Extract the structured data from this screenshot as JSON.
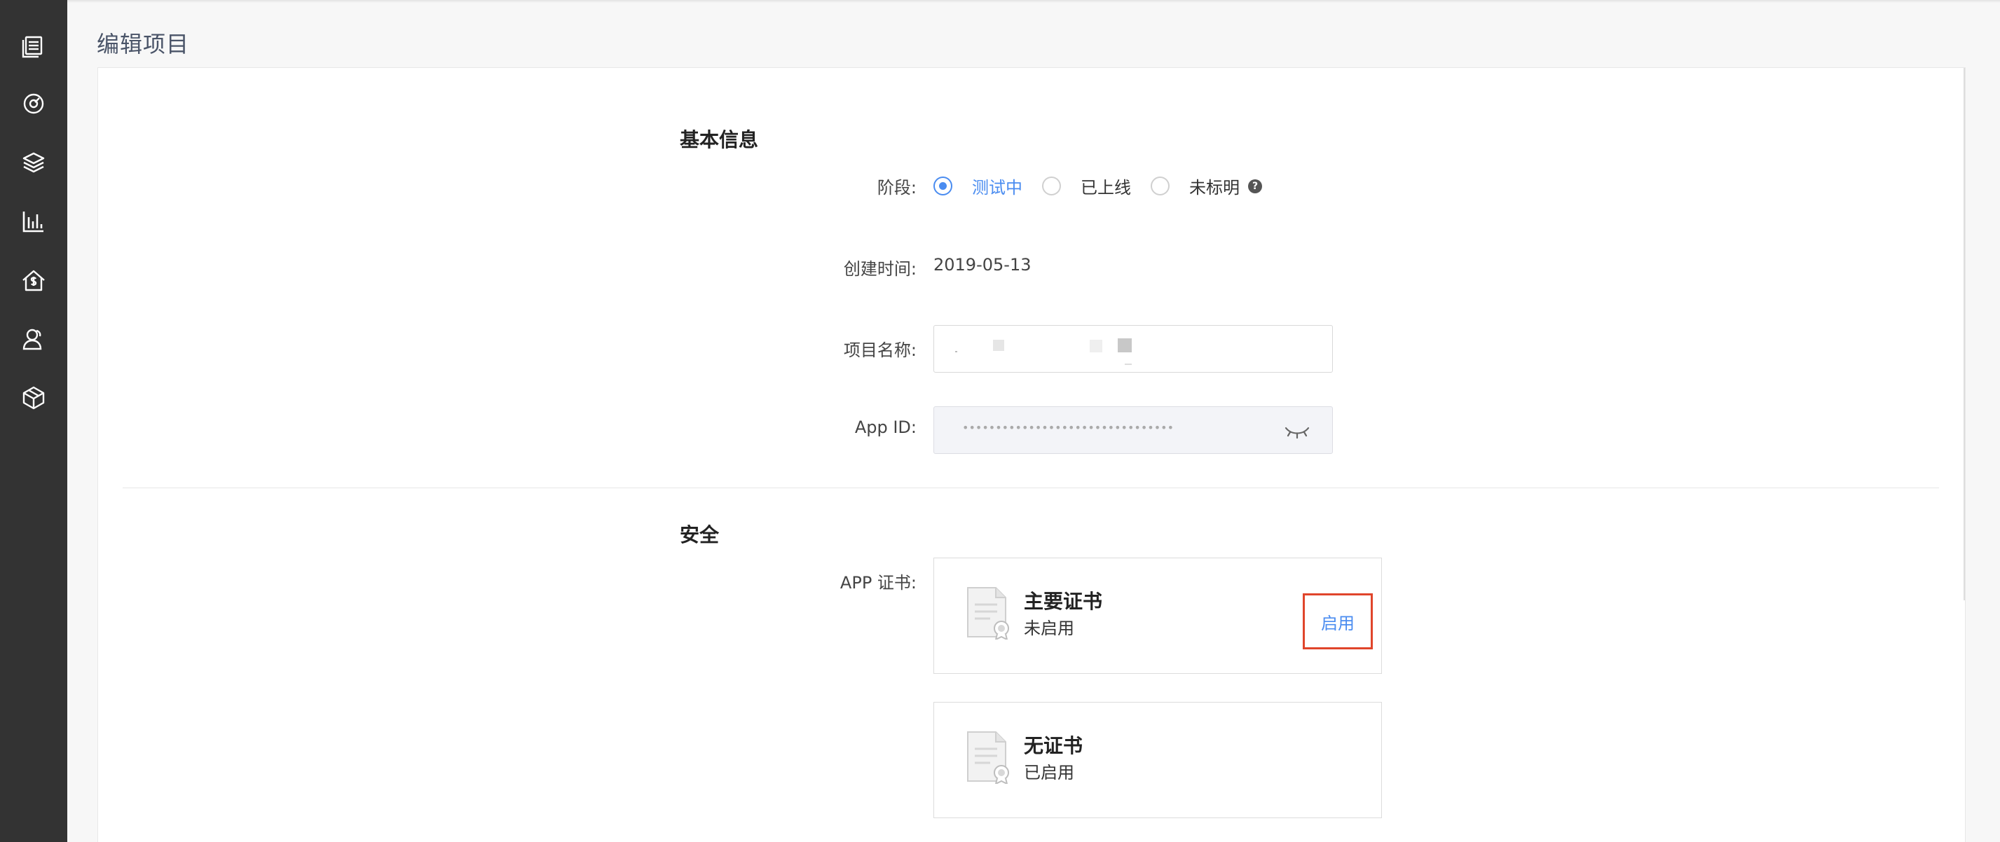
{
  "sidebar": {
    "icons": [
      "list-icon",
      "dashboard-icon",
      "layers-icon",
      "chart-icon",
      "billing-icon",
      "users-icon",
      "box-icon"
    ]
  },
  "page": {
    "title": "编辑项目"
  },
  "basic_info": {
    "section_title": "基本信息",
    "stage_label": "阶段:",
    "stage_options": [
      "测试中",
      "已上线",
      "未标明"
    ],
    "stage_selected": "测试中",
    "created_label": "创建时间:",
    "created_value": "2019-05-13",
    "project_name_label": "项目名称:",
    "app_id_label": "App ID:",
    "app_id_masked": "••••••••••••••••••••••••••••••••"
  },
  "security": {
    "section_title": "安全",
    "cert_label": "APP 证书:",
    "certs": [
      {
        "name": "主要证书",
        "status": "未启用",
        "action": "启用"
      },
      {
        "name": "无证书",
        "status": "已启用"
      }
    ]
  },
  "colors": {
    "accent": "#4a8cf0",
    "highlight_border": "#e0452b",
    "sidebar_bg": "#333333"
  }
}
